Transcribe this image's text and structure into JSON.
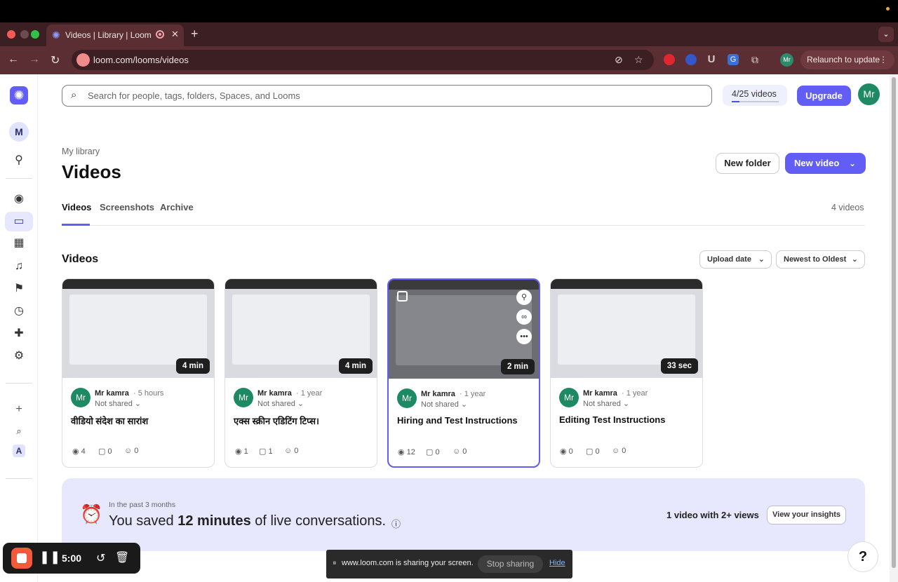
{
  "browser": {
    "tab_title": "Videos | Library | Loom",
    "new_tab": "+",
    "close_tab": "✕",
    "url": "loom.com/looms/videos",
    "relaunch_label": "Relaunch to update",
    "profile_initials": "Mr",
    "extension_u": "U"
  },
  "sidebar": {
    "workspace_initial": "M",
    "bottom_initial": "A"
  },
  "header": {
    "search_placeholder": "Search for people, tags, folders, Spaces, and Looms",
    "quota_label": "4/25 videos",
    "quota_fraction": 0.16,
    "upgrade_label": "Upgrade",
    "avatar_initials": "Mr"
  },
  "library": {
    "breadcrumb": "My library",
    "title": "Videos",
    "new_folder_label": "New folder",
    "new_video_label": "New video",
    "tabs": [
      "Videos",
      "Screenshots",
      "Archive"
    ],
    "video_count": "4 videos",
    "section_title": "Videos",
    "sort_field": "Upload date",
    "sort_order": "Newest to Oldest"
  },
  "videos": [
    {
      "owner": "Mr kamra",
      "time": "5 hours",
      "share": "Not shared",
      "title": "वीडियो संदेश का सारांश",
      "duration": "4 min",
      "views": "4",
      "comments": "0",
      "reactions": "0"
    },
    {
      "owner": "Mr kamra",
      "time": "1 year",
      "share": "Not shared",
      "title": "एक्स स्क्रीन एडिटिंग टिप्स।",
      "duration": "4 min",
      "views": "1",
      "comments": "1",
      "reactions": "0"
    },
    {
      "owner": "Mr kamra",
      "time": "1 year",
      "share": "Not shared",
      "title": "Hiring and Test Instructions",
      "duration": "2 min",
      "views": "12",
      "comments": "0",
      "reactions": "0"
    },
    {
      "owner": "Mr kamra",
      "time": "1 year",
      "share": "Not shared",
      "title": "Editing Test Instructions",
      "duration": "33 sec",
      "views": "0",
      "comments": "0",
      "reactions": "0"
    }
  ],
  "card_avatar_initials": "Mr",
  "insights": {
    "period": "In the past 3 months",
    "saved_prefix": "You saved ",
    "saved_amount": "12 minutes",
    "saved_suffix": " of live conversations.",
    "views_summary": "1 video with 2+ views",
    "button_label": "View your insights"
  },
  "recorder": {
    "timer": "5:00"
  },
  "share_bar": {
    "message": "www.loom.com is sharing your screen.",
    "stop_label": "Stop sharing",
    "hide_label": "Hide"
  },
  "help_label": "?",
  "colors": {
    "accent": "#625df5",
    "avatar": "#1e8a63",
    "insights_bg": "#e7e7fd"
  }
}
